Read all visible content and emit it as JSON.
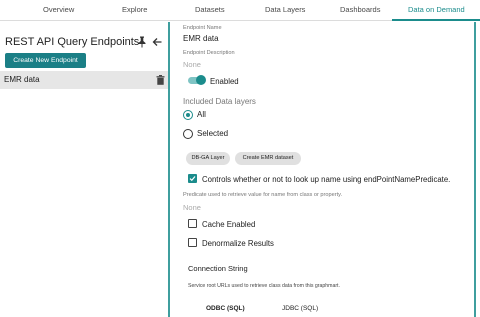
{
  "nav": {
    "tabs": [
      {
        "label": "Overview"
      },
      {
        "label": "Explore"
      },
      {
        "label": "Datasets"
      },
      {
        "label": "Data Layers"
      },
      {
        "label": "Dashboards"
      },
      {
        "label": "Data on Demand",
        "active": true
      }
    ],
    "accent": "#1b8c8c"
  },
  "left_panel": {
    "title": "REST API Query Endpoints",
    "pin_icon": "pin-icon",
    "back_icon": "arrow-left-icon",
    "create_button": "Create New Endpoint",
    "items": [
      {
        "label": "EMR data",
        "selected": true,
        "delete_icon": "trash-icon"
      }
    ]
  },
  "form": {
    "endpoint_name_label": "Endpoint Name",
    "endpoint_name_value": "EMR data",
    "endpoint_description_label": "Endpoint Description",
    "endpoint_description_value": "None",
    "enabled_label": "Enabled",
    "enabled": true,
    "included_layers_label": "Included Data layers",
    "radio_all": "All",
    "radio_selected": "Selected",
    "radio_value": "All",
    "chips": [
      "DB-GA Layer",
      "Create EMR dataset"
    ],
    "lookup_checkbox_label": "Controls whether or not to look up name using endPointNamePredicate.",
    "lookup_checked": true,
    "predicate_label": "Predicate used to retrieve value for name from class or property.",
    "predicate_value": "None",
    "cache_enabled_label": "Cache Enabled",
    "cache_enabled": false,
    "denormalize_label": "Denormalize Results",
    "denormalize": false,
    "connection_string_label": "Connection String",
    "connection_hint": "Service root URLs used to retrieve class data from this graphmart.",
    "connection_tabs": [
      {
        "label": "ODBC (SQL)",
        "selected": true
      },
      {
        "label": "JDBC (SQL)",
        "selected": false
      }
    ]
  }
}
